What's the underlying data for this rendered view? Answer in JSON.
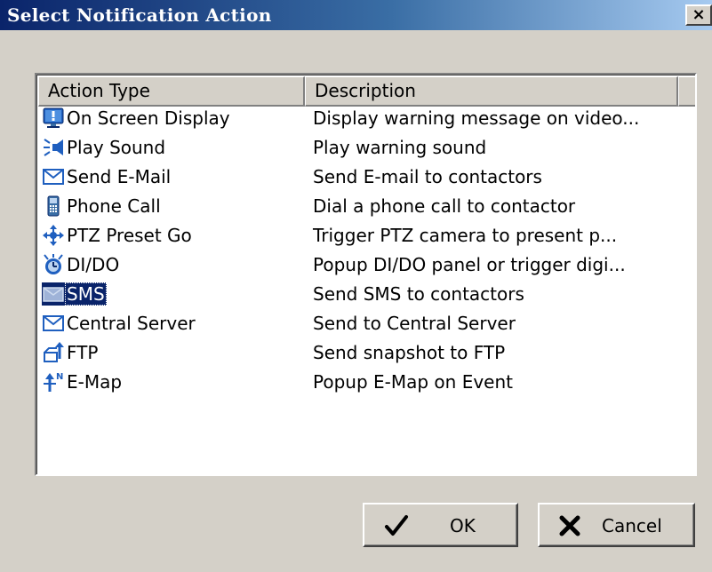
{
  "window": {
    "title": "Select Notification Action",
    "close_label": "×"
  },
  "list": {
    "columns": [
      "Action Type",
      "Description"
    ],
    "rows": [
      {
        "name": "On Screen Display",
        "description": "Display warning message on video...",
        "icon": "monitor-alert-icon"
      },
      {
        "name": "Play Sound",
        "description": "Play warning sound",
        "icon": "speaker-icon"
      },
      {
        "name": "Send E-Mail",
        "description": "Send E-mail to contactors",
        "icon": "envelope-icon"
      },
      {
        "name": "Phone Call",
        "description": "Dial a phone call to contactor",
        "icon": "phone-icon"
      },
      {
        "name": "PTZ Preset Go",
        "description": "Trigger PTZ camera to present p...",
        "icon": "ptz-arrows-icon"
      },
      {
        "name": "DI/DO",
        "description": "Popup DI/DO panel or trigger digi...",
        "icon": "dido-alarm-icon"
      },
      {
        "name": "SMS",
        "description": "Send SMS to contactors",
        "icon": "sms-envelope-icon",
        "selected": true
      },
      {
        "name": "Central Server",
        "description": "Send to Central Server",
        "icon": "envelope-icon"
      },
      {
        "name": "FTP",
        "description": "Send snapshot to FTP",
        "icon": "ftp-upload-icon"
      },
      {
        "name": "E-Map",
        "description": "Popup E-Map on Event",
        "icon": "emap-compass-icon"
      }
    ]
  },
  "buttons": {
    "ok": "OK",
    "cancel": "Cancel"
  },
  "colors": {
    "title_gradient_start": "#0a246a",
    "title_gradient_end": "#a6caf0",
    "selection": "#0a246a",
    "face": "#d4d0c8"
  }
}
